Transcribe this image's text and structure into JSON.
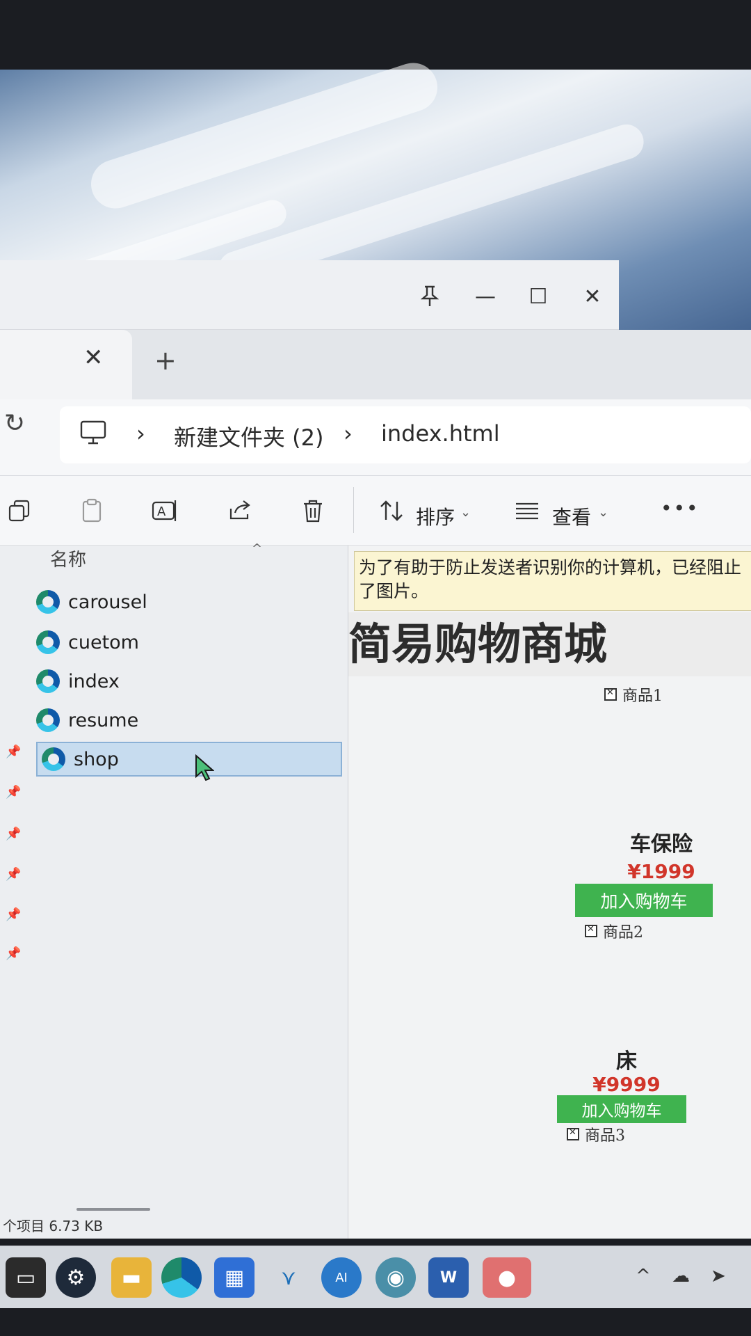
{
  "window": {
    "controls": {
      "pin_icon": "pin-icon",
      "minimize": "—",
      "maximize": "☐",
      "close": "✕"
    }
  },
  "tabs": {
    "close": "✕",
    "new": "+"
  },
  "addressbar": {
    "refresh": "↻",
    "breadcrumb": [
      "新建文件夹 (2)",
      "index.html"
    ],
    "separator": "›"
  },
  "commandbar": {
    "sort_label": "排序",
    "view_label": "查看",
    "more_label": "•••"
  },
  "filelist": {
    "column_header": "名称",
    "files": [
      "carousel",
      "cuetom",
      "index",
      "resume",
      "shop"
    ],
    "selected": "shop",
    "status": "个项目  6.73 KB"
  },
  "preview": {
    "infobar_text": "为了有助于防止发送者识别你的计算机，已经阻止了图片。",
    "shop_title": "简易购物商城",
    "products": [
      {
        "image_alt": "商品1",
        "name": "车保险",
        "price": "¥1999",
        "button": "加入购物车"
      },
      {
        "image_alt": "商品2",
        "name": "床",
        "price": "¥9999",
        "button": "加入购物车"
      },
      {
        "image_alt": "商品3"
      }
    ]
  },
  "taskbar": {
    "icons": [
      "file-explorer-icon",
      "steam-icon",
      "folder-icon",
      "edge-icon",
      "store-icon",
      "vscode-icon",
      "edge-ai-icon",
      "camera-icon",
      "word-icon",
      "wechat-icon"
    ],
    "tray": [
      "chevron-up-icon",
      "cloud-icon",
      "location-icon"
    ]
  },
  "colors": {
    "accent_green": "#3fb34f",
    "price_red": "#d1352a",
    "selection_blue": "#c7dcef",
    "infobar_yellow": "#fbf5d2"
  }
}
